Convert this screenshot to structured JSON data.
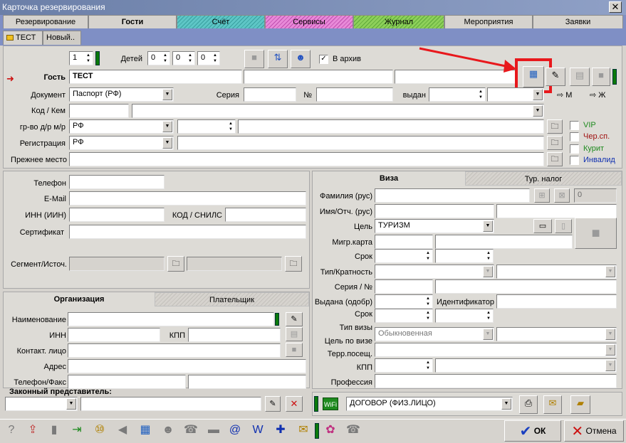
{
  "window": {
    "title": "Карточка резервирования",
    "close": "✕"
  },
  "tabs": [
    {
      "label": "Резервирование",
      "color": "#d6d3ce"
    },
    {
      "label": "Гости",
      "color": "#d6d3ce",
      "active": true
    },
    {
      "label": "Счёт",
      "color": "#5ec6c6"
    },
    {
      "label": "Сервисы",
      "color": "#e26ad0"
    },
    {
      "label": "Журнал",
      "color": "#7ec64a"
    },
    {
      "label": "Мероприятия",
      "color": "#d6d3ce"
    },
    {
      "label": "Заявки",
      "color": "#d6d3ce"
    }
  ],
  "subtabs": {
    "first": "ТЕСТ",
    "second": "Новый.."
  },
  "guest_top": {
    "count": "1",
    "children_label": "Детей",
    "child1": "0",
    "child2": "0",
    "child3": "0",
    "archive_label": "В архив",
    "archive_checked": true
  },
  "guest": {
    "guest_label": "Гость",
    "guest_value": "ТЕСТ",
    "doc_label": "Документ",
    "doc_value": "Паспорт (РФ)",
    "series_label": "Серия",
    "number_label": "№",
    "issued_label": "выдан",
    "gender_m": "М",
    "gender_f": "Ж",
    "issuer_label": "Код / Кем",
    "citizenship_label": "гр-во д/р м/р",
    "citizenship_value": "РФ",
    "registration_label": "Регистрация",
    "registration_value": "РФ",
    "prev_place_label": "Прежнее место"
  },
  "flags": {
    "vip": "VIP",
    "cher": "Чер.сп.",
    "smoker": "Курит",
    "invalid": "Инвалид",
    "vip_color": "#1e8a1e",
    "cher_color": "#a01010",
    "smoker_color": "#1e8a1e",
    "invalid_color": "#1030b0"
  },
  "contacts": {
    "phone_label": "Телефон",
    "email_label": "E-Mail",
    "inn_label": "ИНН (ИИН)",
    "snils_label": "КОД / СНИЛС",
    "cert_label": "Сертификат",
    "segment_label": "Сегмент/Источ."
  },
  "org_tabs": {
    "org": "Организация",
    "payer": "Плательщик"
  },
  "org": {
    "name_label": "Наименование",
    "inn_label": "ИНН",
    "kpp_label": "КПП",
    "contact_label": "Контакт. лицо",
    "address_label": "Адрес",
    "phone_label": "Телефон/Факс"
  },
  "legal_rep": {
    "label": "Законный представитель:"
  },
  "visa_tabs": {
    "visa": "Виза",
    "tax": "Тур. налог"
  },
  "visa": {
    "surname_label": "Фамилия (рус)",
    "count_value": "0",
    "name_label": "Имя/Отч. (рус)",
    "purpose_label": "Цель",
    "purpose_value": "ТУРИЗМ",
    "migr_label": "Мигр.карта",
    "term_label": "Срок",
    "type_label": "Тип/Кратность",
    "series_label": "Серия / №",
    "issued_label": "Выдана (одобр)",
    "ident_label": "Идентификатор",
    "term2_label": "Срок",
    "visa_type_label": "Тип визы",
    "visa_type_value": "Обыкновенная",
    "visa_purpose_label": "Цель по визе",
    "terr_label": "Терр.посещ.",
    "kpp_label": "КПП",
    "profession_label": "Профессия"
  },
  "contract": {
    "value": "ДОГОВОР (ФИЗ.ЛИЦО)"
  },
  "footer": {
    "ok": "ОК",
    "cancel": "Отмена",
    "ok_color": "#1a3fc0",
    "cancel_color": "#cc1010"
  },
  "highlight": {
    "color": "#e8181c"
  }
}
